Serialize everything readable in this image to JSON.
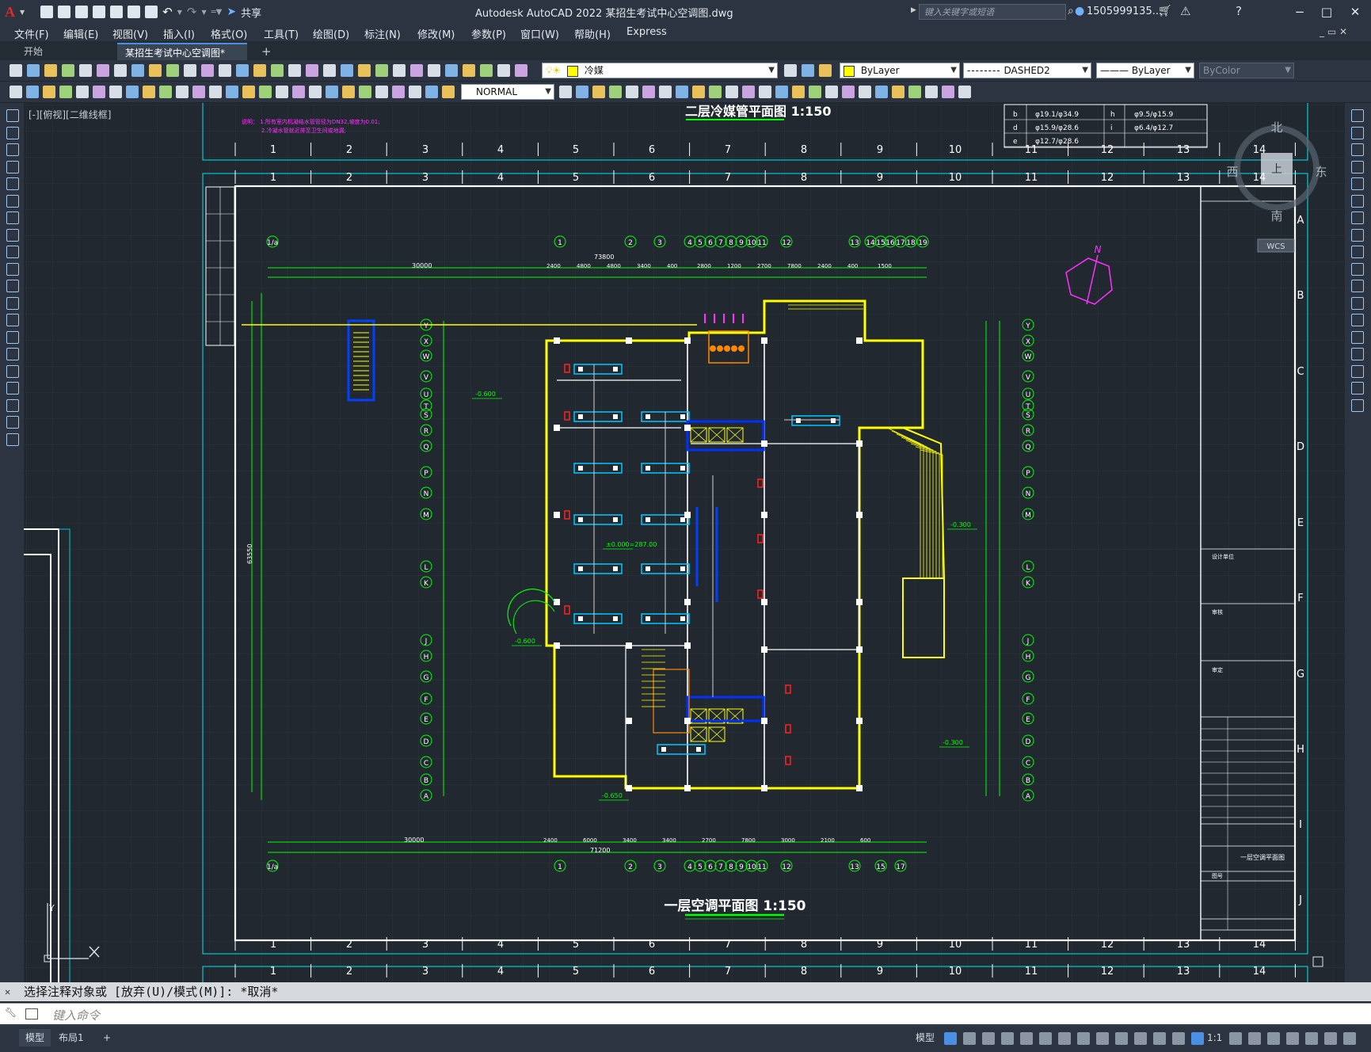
{
  "app": {
    "title": "Autodesk AutoCAD 2022    某招生考试中心空调图.dwg",
    "logo": "A",
    "share_label": "共享",
    "search_placeholder": "键入关键字或短语",
    "user": "1505999135...",
    "window_controls": [
      "−",
      "□",
      "✕"
    ]
  },
  "menu": [
    "文件(F)",
    "编辑(E)",
    "视图(V)",
    "插入(I)",
    "格式(O)",
    "工具(T)",
    "绘图(D)",
    "标注(N)",
    "修改(M)",
    "参数(P)",
    "窗口(W)",
    "帮助(H)",
    "Express"
  ],
  "tabs": {
    "start": "开始",
    "file": "某招生考试中心空调图*",
    "close": "✕",
    "add": "+"
  },
  "properties": {
    "layer": "冷媒",
    "color": "ByLayer",
    "linetype": "DASHED2",
    "lineweight": "ByLayer",
    "plotstyle": "ByColor",
    "textstyle": "NORMAL"
  },
  "viewport_label": "[-][俯视][二维线框]",
  "drawing": {
    "top_title": "二层冷媒管平面图  1:150",
    "main_title": "一层空调平面图  1:150",
    "grid_cols": [
      "1",
      "2",
      "3",
      "4",
      "5",
      "6",
      "7",
      "8",
      "9",
      "10",
      "11",
      "12",
      "13",
      "14"
    ],
    "grid_rows": [
      "A",
      "B",
      "C",
      "D",
      "E",
      "F",
      "G",
      "H",
      "I",
      "J"
    ],
    "axis_letters": [
      "Y",
      "X",
      "W",
      "V",
      "U",
      "T",
      "S",
      "R",
      "Q",
      "P",
      "N",
      "M",
      "L",
      "K",
      "J",
      "H",
      "G",
      "F",
      "E",
      "D",
      "C",
      "B",
      "A"
    ],
    "top_axis_nums": [
      "1/a",
      "1",
      "2",
      "3",
      "4",
      "5",
      "6",
      "7",
      "8",
      "9",
      "10",
      "11",
      "12",
      "13",
      "14",
      "15",
      "16",
      "17",
      "18",
      "19"
    ],
    "bottom_axis_nums": [
      "1/a",
      "1",
      "2",
      "3",
      "4",
      "5",
      "6",
      "7",
      "8",
      "9",
      "10",
      "11",
      "12",
      "13",
      "15",
      "17"
    ],
    "dims_top": [
      "73800",
      "30000",
      "2400",
      "4800",
      "4800",
      "3400",
      "400",
      "2800",
      "1200",
      "2700",
      "7800",
      "2400",
      "400",
      "1500"
    ],
    "dims_bottom": [
      "71200",
      "30000",
      "2400",
      "6000",
      "3400",
      "3400",
      "2700",
      "7800",
      "3000",
      "2100",
      "600"
    ],
    "left_dim": "63550",
    "notes_top": [
      "说明： 1.所有室内机凝结水管管径为DN32,坡度为0.01;",
      "2.冷凝水管就近排至卫生间或地漏;"
    ],
    "elevation_tags": [
      "-0.600",
      "-0.300",
      "-0.300",
      "±0.000=287.00",
      "-0.650",
      "-0.600"
    ],
    "pipe_table": [
      [
        "b",
        "φ19.1/φ34.9",
        "h",
        "φ9.5/φ15.9"
      ],
      [
        "d",
        "φ15.9/φ28.6",
        "i",
        "φ6.4/φ12.7"
      ],
      [
        "e",
        "φ12.7/φ28.6",
        "",
        ""
      ]
    ],
    "title_block": [
      "一层空调平面图",
      "设计单位",
      "审核",
      "审定",
      "图号"
    ],
    "compass": {
      "n": "北",
      "s": "南",
      "e": "东",
      "w": "西",
      "center": "上",
      "wcs": "WCS"
    },
    "north_mark": "N"
  },
  "command": {
    "history": "选择注释对象或 [放弃(U)/模式(M)]: *取消*",
    "placeholder": "键入命令"
  },
  "status": {
    "model_tab": "模型",
    "layout_tab": "布局1",
    "add": "+",
    "model_label": "模型",
    "scale": "1:1"
  },
  "colors": {
    "accent": "#4a90e2",
    "bg": "#212830",
    "wall": "#ffff00",
    "dim": "#00ff00",
    "frame": "#ffffff",
    "cyan": "#00c8d0"
  }
}
